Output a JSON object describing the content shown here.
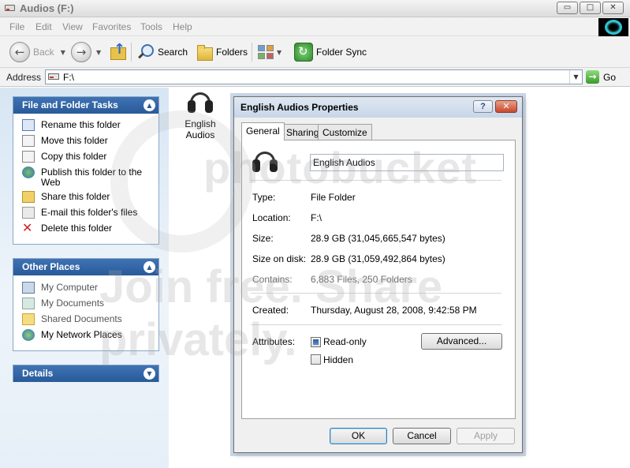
{
  "window": {
    "title": "Audios (F:)",
    "buttons": {
      "minimize": "▭",
      "maximize": "□",
      "close": "✕"
    }
  },
  "menu": [
    "File",
    "Edit",
    "View",
    "Favorites",
    "Tools",
    "Help"
  ],
  "toolbar": {
    "back_label": "Back",
    "search_label": "Search",
    "folders_label": "Folders",
    "sync_label": "Folder Sync",
    "dropdown_glyph": "▼"
  },
  "address": {
    "label": "Address",
    "value": "F:\\",
    "go_label": "Go"
  },
  "tasks": {
    "file_folder": {
      "title": "File and Folder Tasks",
      "items": [
        {
          "label": "Rename this folder",
          "icon": "rename-icon"
        },
        {
          "label": "Move this folder",
          "icon": "move-icon"
        },
        {
          "label": "Copy this folder",
          "icon": "copy-icon"
        },
        {
          "label": "Publish this folder to the Web",
          "icon": "publish-web-icon"
        },
        {
          "label": "Share this folder",
          "icon": "share-icon"
        },
        {
          "label": "E-mail this folder's files",
          "icon": "email-icon"
        },
        {
          "label": "Delete this folder",
          "icon": "delete-icon"
        }
      ]
    },
    "other_places": {
      "title": "Other Places",
      "items": [
        {
          "label": "My Computer",
          "icon": "computer-icon"
        },
        {
          "label": "My Documents",
          "icon": "documents-icon"
        },
        {
          "label": "Shared Documents",
          "icon": "shared-folder-icon"
        },
        {
          "label": "My Network Places",
          "icon": "network-icon"
        }
      ]
    },
    "details": {
      "title": "Details"
    }
  },
  "content": {
    "folder_name": "English Audios"
  },
  "dialog": {
    "title": "English Audios Properties",
    "help": "?",
    "close": "✕",
    "tabs": [
      "General",
      "Sharing",
      "Customize"
    ],
    "name_value": "English Audios",
    "properties": [
      {
        "label": "Type:",
        "value": "File Folder"
      },
      {
        "label": "Location:",
        "value": "F:\\"
      },
      {
        "label": "Size:",
        "value": "28.9 GB (31,045,665,547 bytes)"
      },
      {
        "label": "Size on disk:",
        "value": "28.9 GB (31,059,492,864 bytes)"
      },
      {
        "label": "Contains:",
        "value": "6,883 Files, 250 Folders"
      },
      {
        "label": "Created:",
        "value": "Thursday, August 28, 2008, 9:42:58 PM"
      }
    ],
    "attributes_label": "Attributes:",
    "readonly_label": "Read-only",
    "hidden_label": "Hidden",
    "advanced_label": "Advanced...",
    "ok_label": "OK",
    "cancel_label": "Cancel",
    "apply_label": "Apply"
  },
  "watermark": {
    "brand": "photobucket",
    "tagline": "Join free. Share privately."
  }
}
